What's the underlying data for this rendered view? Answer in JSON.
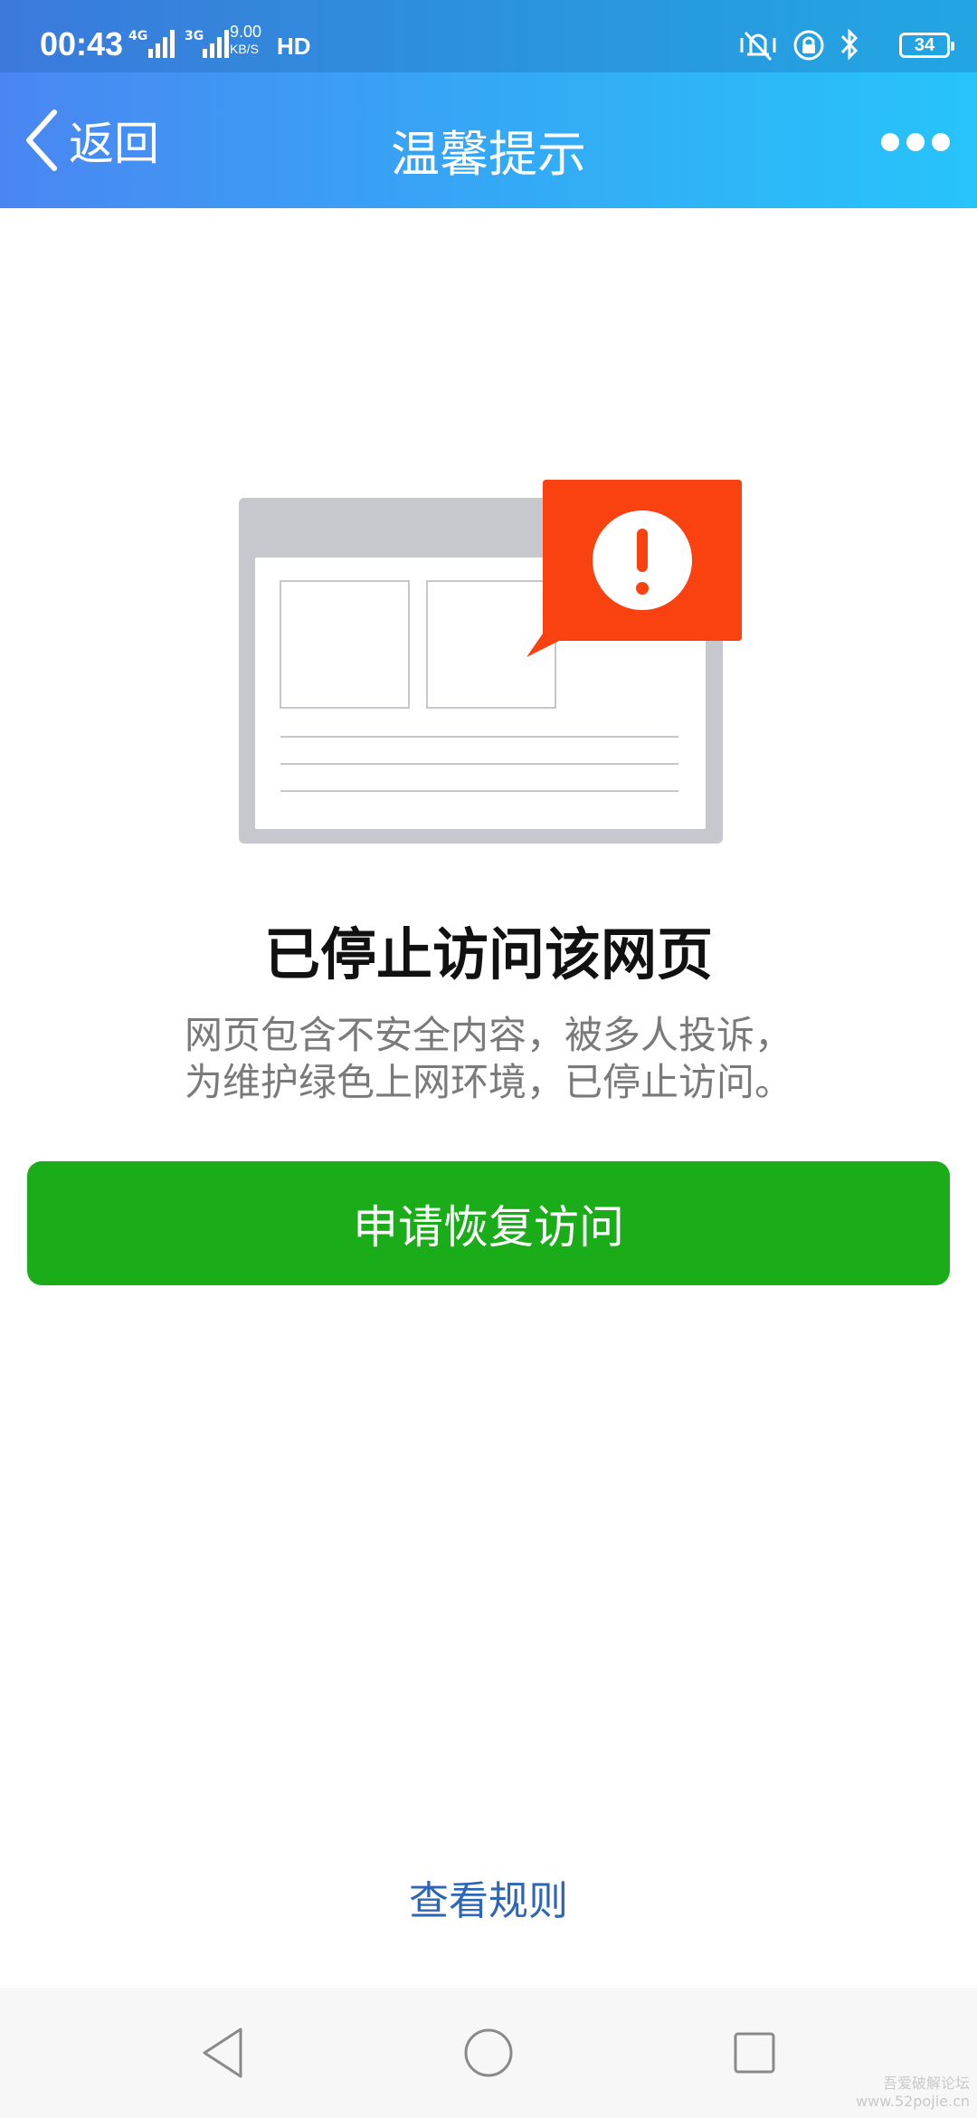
{
  "status_bar": {
    "time": "00:43",
    "network_1": "4G",
    "network_2": "3G",
    "speed_value": "9.00",
    "speed_unit": "KB/S",
    "hd_label": "HD",
    "battery_level": "34"
  },
  "nav": {
    "back_label": "返回",
    "title": "温馨提示"
  },
  "block": {
    "title": "已停止访问该网页",
    "desc_line1": "网页包含不安全内容，被多人投诉，",
    "desc_line2": "为维护绿色上网环境，已停止访问。"
  },
  "actions": {
    "restore_label": "申请恢复访问",
    "rules_label": "查看规则"
  },
  "watermark": {
    "line1": "吾爱破解论坛",
    "line2": "www.52pojie.cn"
  },
  "colors": {
    "header_gradient": [
      "#4a86f2",
      "#27c4fb"
    ],
    "button_green": "#1aad19",
    "alert_red": "#fa4110",
    "link_blue": "#2f66b4"
  }
}
